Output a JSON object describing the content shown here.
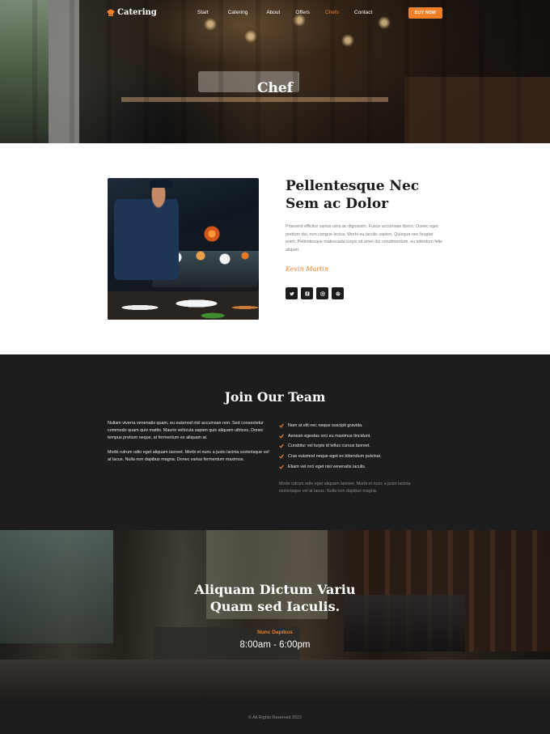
{
  "nav": {
    "logo_text": "Catering",
    "items": [
      {
        "label": "Start",
        "active": false
      },
      {
        "label": "Catering",
        "active": false
      },
      {
        "label": "About",
        "active": false
      },
      {
        "label": "Offers",
        "active": false
      },
      {
        "label": "Chefs",
        "active": true
      },
      {
        "label": "Contact",
        "active": false
      }
    ],
    "buy_label": "BUY NOW"
  },
  "hero": {
    "title": "Chef"
  },
  "chef": {
    "heading": "Pellentesque Nec Sem ac Dolor",
    "paragraph": "Praesent efficitur varius urna ac dignissim. Fusce accumsan libero. Donec eget pretium dui, non congue lectus. Morbi eu iaculis sapien. Quisque nec feugiat enim. Pellentesque malesuada turpis sit amet dui condimentum, eu interdum felis aliquet.",
    "signature": "Kevin Martin",
    "socials": [
      "twitter-icon",
      "facebook-icon",
      "instagram-icon",
      "pinterest-icon"
    ]
  },
  "join": {
    "title": "Join Our Team",
    "para1": "Nullam viverra venenatis quam, eu euismod nisl accumsan non. Sed consectetur commodo quam quis mattis. Mauris vehicula sapien quis aliquam ultrices. Donec tempus pretium neque, at fermentum ex aliquam at.",
    "para2": "Morbi rutrum odio eget aliquam laoreet. Morbi et nunc a justo lacinia scelerisque vel at lacus. Nulla non dapibus magna. Donec varius fermentum maximus.",
    "list": [
      "Nam at elit nec neque suscipit gravida.",
      "Aenean egestas orci eu maximus tincidunt.",
      "Curabitur vel turpis id tellus cursus laoreet.",
      "Cras euismod neque eget ex bibendum pulvinar.",
      "Etiam vel orci eget nisi venenatis iaculis."
    ],
    "note": "Morbi rutrum odio eget aliquam laoreet. Morbi et nunc a justo lacinia scelerisque vel at lacus. Nulla non dapibus magna."
  },
  "hours": {
    "title_line1": "Aliquam Dictum Variu",
    "title_line2": "Quam sed Iaculis.",
    "label": "Nunc Dapibus",
    "time": "8:00am - 6:00pm"
  },
  "footer": {
    "copyright": "© All Rights Reserved 2022"
  },
  "colors": {
    "accent": "#f07f2a",
    "dark": "#1d1d1d"
  }
}
